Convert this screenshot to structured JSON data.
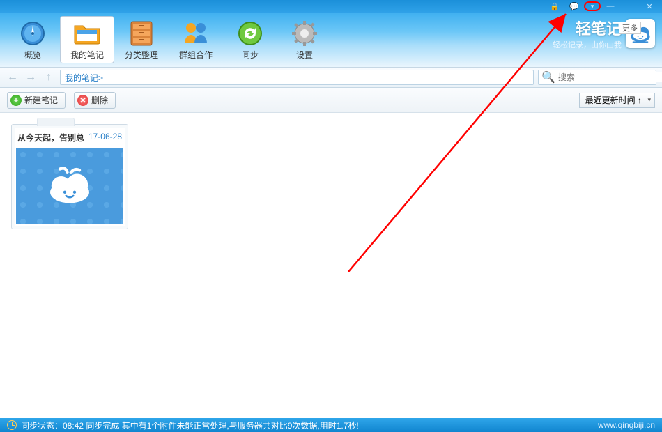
{
  "titlebar": {
    "sys": {
      "lock": "🔒",
      "chat": "💬",
      "dropdown": "▾",
      "min": "—",
      "max": "☐",
      "close": "✕"
    }
  },
  "toolbar": {
    "items": [
      {
        "key": "overview",
        "label": "概览"
      },
      {
        "key": "mynotes",
        "label": "我的笔记"
      },
      {
        "key": "category",
        "label": "分类整理"
      },
      {
        "key": "group",
        "label": "群组合作"
      },
      {
        "key": "sync",
        "label": "同步"
      },
      {
        "key": "settings",
        "label": "设置"
      }
    ]
  },
  "brand": {
    "title": "轻笔记",
    "sub": "轻松记录，由你由我",
    "more": "更多"
  },
  "nav": {
    "breadcrumb": "我的笔记>",
    "search_placeholder": "搜索"
  },
  "actions": {
    "new_note": "新建笔记",
    "delete": "删除",
    "sort": "最近更新时间 ↑"
  },
  "note": {
    "title": "从今天起，告别总",
    "date": "17-06-28"
  },
  "status": {
    "text": "同步状态：08:42 同步完成 其中有1个附件未能正常处理,与服务器共对比9次数据,用时1.7秒!",
    "url": "www.qingbiji.cn"
  }
}
